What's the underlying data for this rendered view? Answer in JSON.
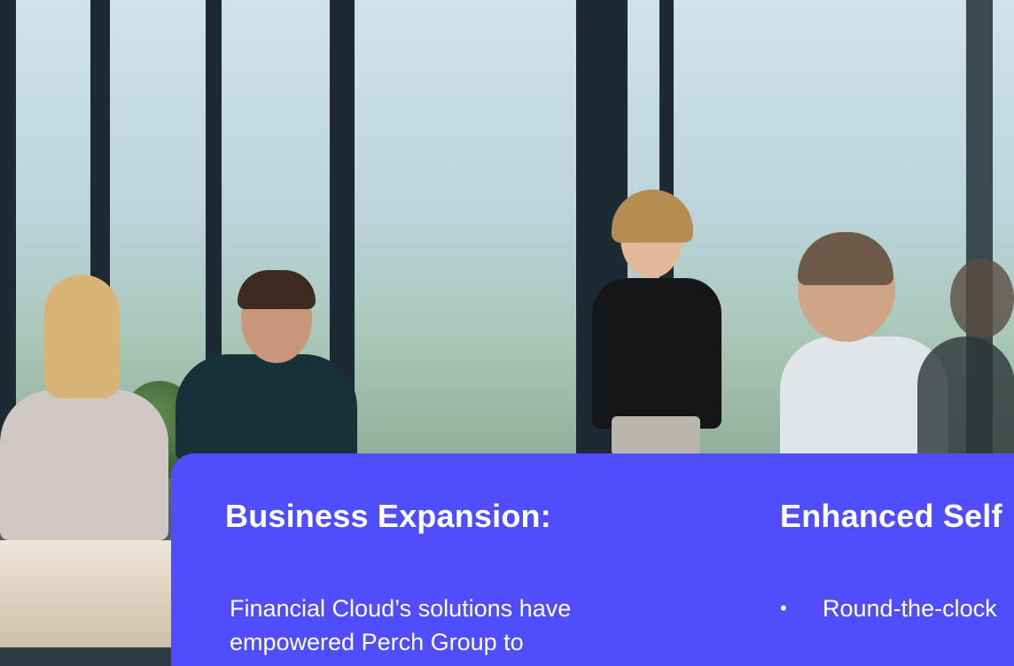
{
  "hero_image": {
    "alt": ""
  },
  "sections": [
    {
      "title": "Business Expansion:",
      "body_lines": [
        "Financial Cloud’s solutions have",
        "empowered Perch Group to"
      ]
    },
    {
      "title": "Enhanced Self",
      "bullets": [
        {
          "marker": "•",
          "text": "Round-the-clock"
        }
      ]
    }
  ],
  "colors": {
    "card_bg": "#4e4efd",
    "text": "#ffffff"
  }
}
